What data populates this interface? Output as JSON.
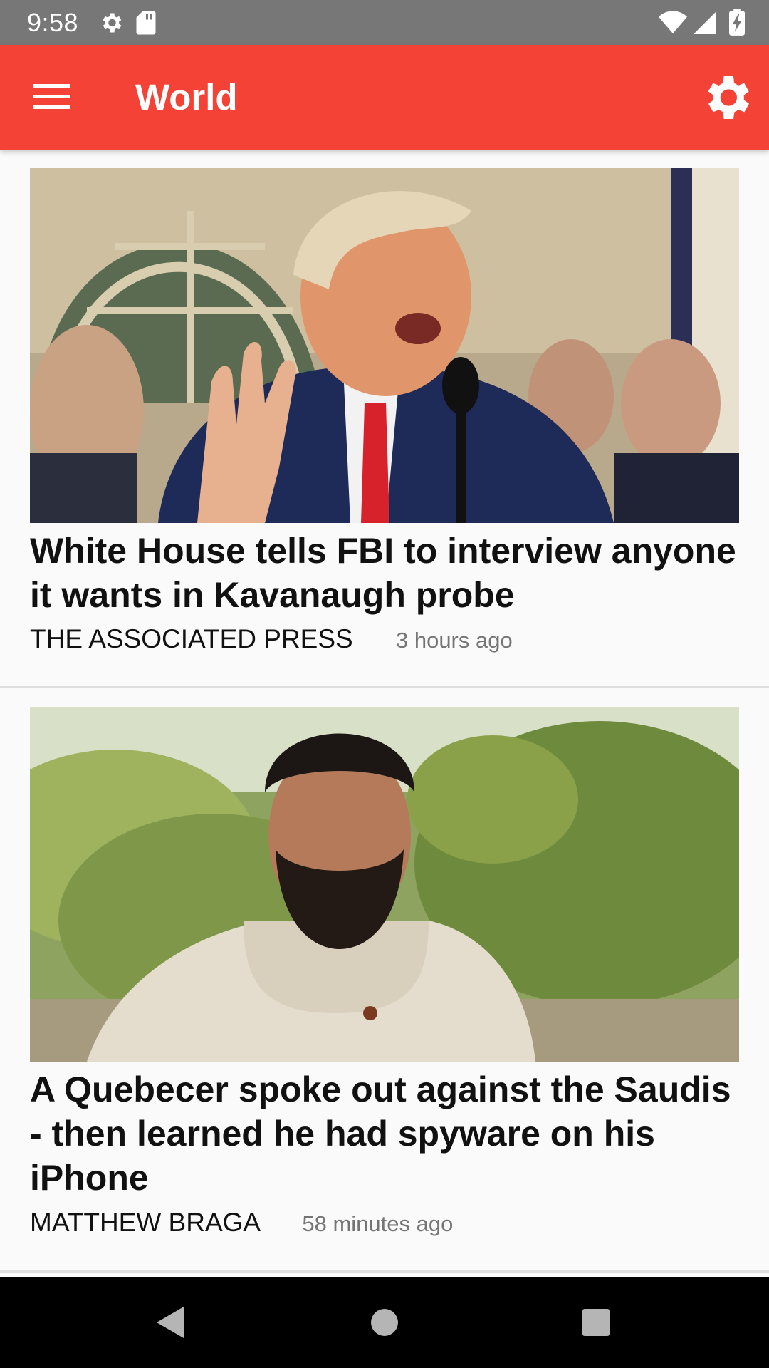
{
  "status_bar": {
    "time": "9:58",
    "left_icons": [
      "gear-icon",
      "sd-card-icon"
    ],
    "right_icons": [
      "wifi-icon",
      "cell-signal-icon",
      "battery-charging-icon"
    ]
  },
  "app_bar": {
    "title": "World",
    "menu_icon": "hamburger-menu-icon",
    "settings_icon": "gear-icon",
    "color": "#f44336"
  },
  "articles": [
    {
      "title": "White House tells FBI to interview anyone it wants in Kavanaugh probe",
      "source": "THE ASSOCIATED PRESS",
      "time": "3 hours ago"
    },
    {
      "title": "A Quebecer spoke out against the Saudis - then learned he had spyware on his iPhone",
      "source": "MATTHEW BRAGA",
      "time": "58 minutes ago"
    }
  ],
  "nav_bar": {
    "buttons": [
      "back-icon",
      "home-icon",
      "recents-icon"
    ]
  }
}
